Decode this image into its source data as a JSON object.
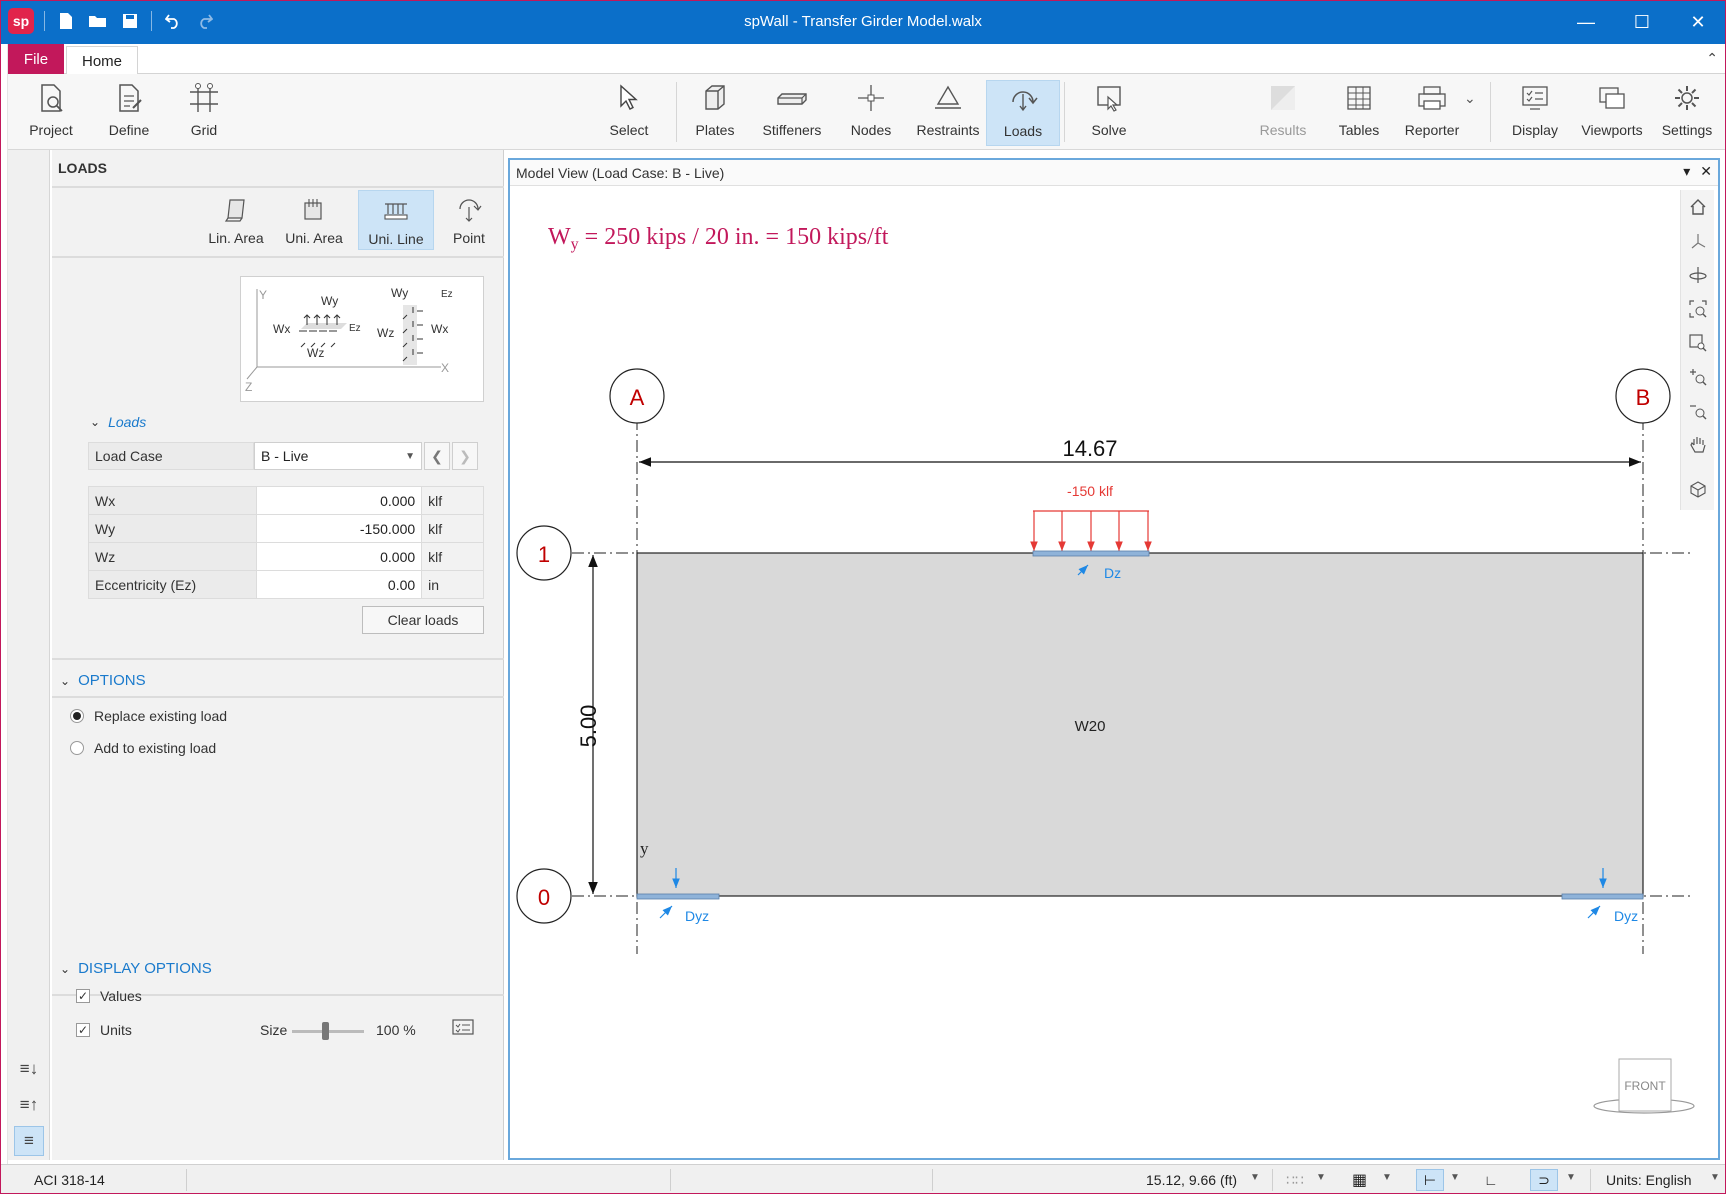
{
  "app": {
    "title": "spWall - Transfer Girder Model.walx",
    "logo_text": "sp"
  },
  "tabs": {
    "file": "File",
    "home": "Home"
  },
  "ribbon": {
    "project": "Project",
    "define": "Define",
    "grid": "Grid",
    "select": "Select",
    "plates": "Plates",
    "stiffeners": "Stiffeners",
    "nodes": "Nodes",
    "restraints": "Restraints",
    "loads": "Loads",
    "solve": "Solve",
    "results": "Results",
    "tables": "Tables",
    "reporter": "Reporter",
    "display": "Display",
    "viewports": "Viewports",
    "settings": "Settings"
  },
  "panel": {
    "title": "LOADS",
    "load_types": {
      "lin_area": "Lin. Area",
      "uni_area": "Uni. Area",
      "uni_line": "Uni. Line",
      "point": "Point"
    },
    "diagram_labels": {
      "y": "Y",
      "z": "Z",
      "x": "X",
      "wy1": "Wy",
      "wx1": "Wx",
      "wz1": "Wz",
      "ez1": "Ez",
      "wy2": "Wy",
      "wx2": "Wx",
      "wz2": "Wz",
      "ez2": "Ez"
    },
    "loads_section": "Loads",
    "load_case_label": "Load Case",
    "load_case_value": "B - Live",
    "props": [
      {
        "key": "Wx",
        "value": "0.000",
        "unit": "klf"
      },
      {
        "key": "Wy",
        "value": "-150.000",
        "unit": "klf"
      },
      {
        "key": "Wz",
        "value": "0.000",
        "unit": "klf"
      },
      {
        "key": "Eccentricity (Ez)",
        "value": "0.00",
        "unit": "in"
      }
    ],
    "clear_loads": "Clear loads",
    "options_section": "OPTIONS",
    "options": {
      "replace": "Replace existing load",
      "add": "Add to existing load"
    },
    "display_section": "DISPLAY OPTIONS",
    "display": {
      "values": "Values",
      "units": "Units",
      "size_label": "Size",
      "size_value": "100 %"
    }
  },
  "model_view": {
    "header": "Model View (Load Case: B - Live)",
    "annotation": {
      "w": "W",
      "sub": "y",
      "rest": " = 250 kips / 20 in. = 150 kips/ft"
    },
    "grid_a": "A",
    "grid_b": "B",
    "grid_1": "1",
    "grid_0": "0",
    "dim_horizontal": "14.67",
    "dim_vertical": "5.00",
    "load_label": "-150 klf",
    "dz_label": "Dz",
    "dyz_left": "Dyz",
    "dyz_right": "Dyz",
    "plate_label": "W20",
    "axis_y": "y",
    "front_cube": "FRONT"
  },
  "status": {
    "code": "ACI 318-14",
    "coords": "15.12, 9.66 (ft)",
    "units": "Units:  English"
  },
  "colors": {
    "titlebar": "#0b6fc9",
    "file_tab": "#c2185b",
    "annotation": "#c2185b",
    "grid_bubble": "#c00000",
    "load": "#e53935",
    "restraint": "#1e88e5",
    "plate": "#d9d9d9",
    "accent": "#1a7acc"
  }
}
